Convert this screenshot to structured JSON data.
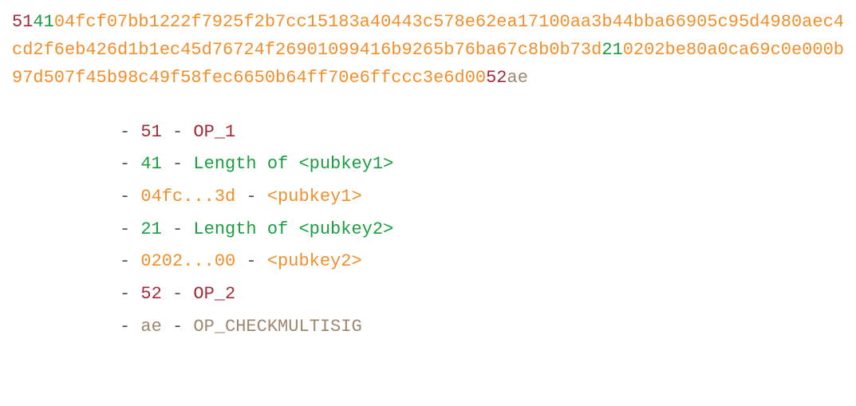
{
  "hex": {
    "seg0": "51",
    "seg1": "41",
    "seg2_a": "04fcf07bb1222f7925f2b7cc15183a40443c578e62ea17100aa3b44bba66905c95d4980aec4cd2f6eb426d1b1ec45d76724f26901099416b9265b76ba67c8b0b73d",
    "seg3": "21",
    "seg4": "0202be80a0ca69c0e000b97d507f45b98c49f58fec6650b64ff70e6ffccc3e6d00",
    "seg5": "52",
    "seg6": "ae"
  },
  "legend": {
    "items": [
      {
        "color": "c-crimson",
        "byte": "51",
        "desc": "OP_1"
      },
      {
        "color": "c-green",
        "byte": "41",
        "desc": "Length of <pubkey1>"
      },
      {
        "color": "c-orange",
        "byte": "04fc...3d",
        "desc": "<pubkey1>"
      },
      {
        "color": "c-green",
        "byte": "21",
        "desc": "Length of <pubkey2>"
      },
      {
        "color": "c-orange",
        "byte": "0202...00",
        "desc": "<pubkey2>"
      },
      {
        "color": "c-crimson",
        "byte": "52",
        "desc": "OP_2"
      },
      {
        "color": "c-brown",
        "byte": "ae",
        "desc": "OP_CHECKMULTISIG"
      }
    ]
  }
}
